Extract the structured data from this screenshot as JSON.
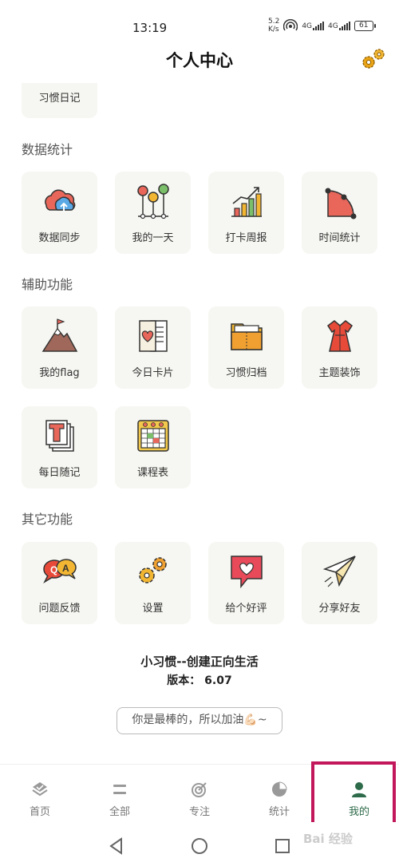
{
  "status_bar": {
    "time": "13:19",
    "net_speed_value": "5.2",
    "net_speed_unit": "K/s",
    "signal1_label": "4G",
    "signal2_label": "4G",
    "battery": "61"
  },
  "header": {
    "title": "个人中心"
  },
  "partial_card": {
    "label": "习惯日记"
  },
  "sections": {
    "stats": {
      "title": "数据统计",
      "items": [
        {
          "label": "数据同步",
          "icon": "cloud-sync-icon"
        },
        {
          "label": "我的一天",
          "icon": "timeline-pins-icon"
        },
        {
          "label": "打卡周报",
          "icon": "bar-chart-trend-icon"
        },
        {
          "label": "时间统计",
          "icon": "pie-quarter-icon"
        }
      ]
    },
    "aux": {
      "title": "辅助功能",
      "items": [
        {
          "label": "我的flag",
          "icon": "mountain-flag-icon"
        },
        {
          "label": "今日卡片",
          "icon": "heart-card-icon"
        },
        {
          "label": "习惯归档",
          "icon": "folder-archive-icon"
        },
        {
          "label": "主题装饰",
          "icon": "dress-icon"
        },
        {
          "label": "每日随记",
          "icon": "text-document-icon"
        },
        {
          "label": "课程表",
          "icon": "schedule-grid-icon"
        }
      ]
    },
    "other": {
      "title": "其它功能",
      "items": [
        {
          "label": "问题反馈",
          "icon": "qa-bubbles-icon"
        },
        {
          "label": "设置",
          "icon": "gears-icon"
        },
        {
          "label": "给个好评",
          "icon": "heart-bubble-icon"
        },
        {
          "label": "分享好友",
          "icon": "paper-plane-icon"
        }
      ]
    }
  },
  "footer": {
    "slogan": "小习惯--创建正向生活",
    "version": "版本： 6.07",
    "cheer_button": "你是最棒的，所以加油💪🏻~"
  },
  "tabbar": {
    "tabs": [
      {
        "label": "首页"
      },
      {
        "label": "全部"
      },
      {
        "label": "专注"
      },
      {
        "label": "统计"
      },
      {
        "label": "我的"
      }
    ],
    "active_index": 4
  },
  "watermark": "Bai 经验",
  "colors": {
    "accent": "#2e6b4a",
    "card_bg": "#f6f6f2",
    "highlight": "#c2185b"
  }
}
